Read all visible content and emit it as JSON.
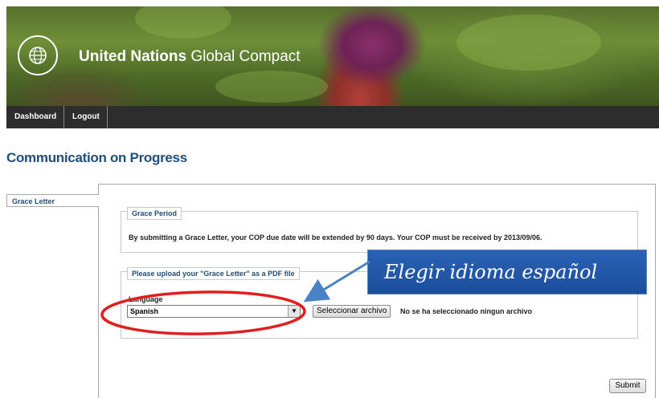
{
  "header": {
    "brand_bold": "United Nations",
    "brand_light": "Global Compact",
    "logo_text": "THE GLOBAL COMPACT"
  },
  "nav": {
    "items": [
      {
        "label": "Dashboard"
      },
      {
        "label": "Logout"
      }
    ]
  },
  "page": {
    "title": "Communication on Progress"
  },
  "tabs": [
    {
      "label": "Grace Letter"
    }
  ],
  "grace_period": {
    "legend": "Grace Period",
    "text": "By submitting a Grace Letter, your COP due date will be extended by 90 days. Your COP must be received by 2013/09/06."
  },
  "upload": {
    "legend": "Please upload your \"Grace Letter\" as a PDF file",
    "language_label": "Language",
    "language_selected": "Spanish",
    "file_button": "Seleccionar archivo",
    "file_status": "No se ha seleccionado ningun archivo"
  },
  "actions": {
    "submit_label": "Submit"
  },
  "annotation": {
    "callout_text": "Elegir idioma español",
    "colors": {
      "callout": "#1f58a8",
      "highlight": "#e01e1e"
    }
  }
}
